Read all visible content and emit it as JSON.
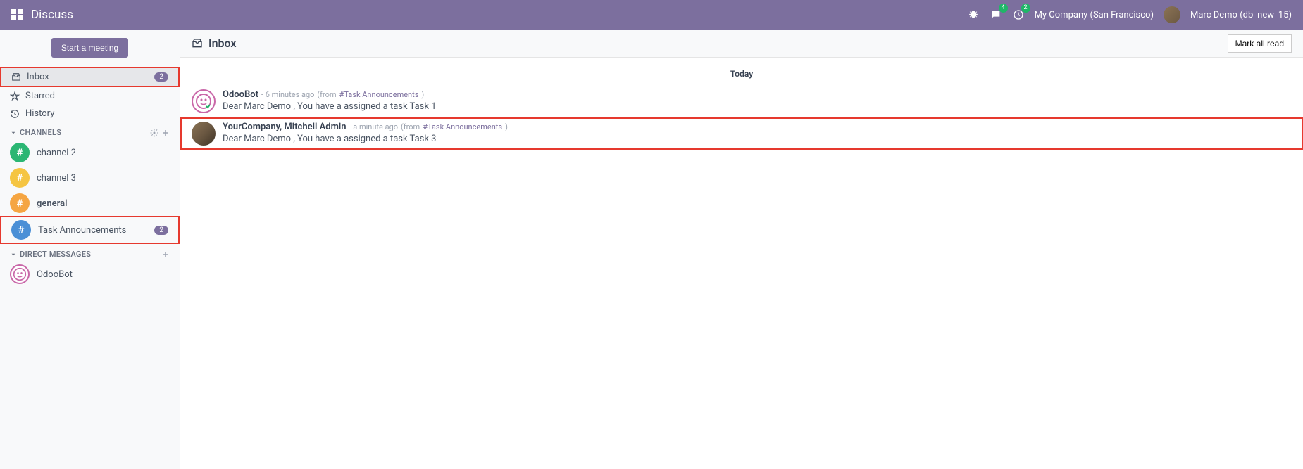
{
  "navbar": {
    "title": "Discuss",
    "chat_badge": "4",
    "activity_badge": "2",
    "company": "My Company (San Francisco)",
    "user": "Marc Demo (db_new_15)"
  },
  "sidebar": {
    "start_meeting": "Start a meeting",
    "mailboxes": [
      {
        "icon": "inbox",
        "label": "Inbox",
        "badge": "2",
        "active": true
      },
      {
        "icon": "star",
        "label": "Starred",
        "badge": null,
        "active": false
      },
      {
        "icon": "history",
        "label": "History",
        "badge": null,
        "active": false
      }
    ],
    "channels_label": "CHANNELS",
    "channels": [
      {
        "label": "channel 2",
        "color": "#2bb673",
        "badge": null,
        "bold": false
      },
      {
        "label": "channel 3",
        "color": "#f5c542",
        "badge": null,
        "bold": false
      },
      {
        "label": "general",
        "color": "#f5a542",
        "badge": null,
        "bold": true
      },
      {
        "label": "Task Announcements",
        "color": "#4a8fd6",
        "badge": "2",
        "bold": false
      }
    ],
    "dm_label": "DIRECT MESSAGES",
    "dms": [
      {
        "label": "OdooBot"
      }
    ]
  },
  "content": {
    "title": "Inbox",
    "mark_all_read": "Mark all read",
    "date_separator": "Today",
    "messages": [
      {
        "author": "OdooBot",
        "time": "- 6 minutes ago",
        "from_label": "(from",
        "channel_link": "Task Announcements",
        "close_paren": ")",
        "body": "Dear Marc Demo , You have a assigned a task Task 1",
        "avatar_type": "odoobot",
        "highlighted": false
      },
      {
        "author": "YourCompany, Mitchell Admin",
        "time": "- a minute ago",
        "from_label": "(from",
        "channel_link": "Task Announcements",
        "close_paren": ")",
        "body": "Dear Marc Demo , You have a assigned a task Task 3",
        "avatar_type": "mitchell",
        "highlighted": true
      }
    ]
  }
}
